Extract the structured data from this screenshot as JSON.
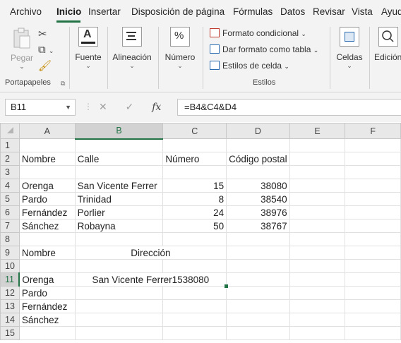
{
  "menu": {
    "tabs": [
      "Archivo",
      "Inicio",
      "Insertar",
      "Disposición de página",
      "Fórmulas",
      "Datos",
      "Revisar",
      "Vista",
      "Ayud"
    ],
    "active": "Inicio"
  },
  "ribbon": {
    "clipboard": {
      "paste_label": "Pegar",
      "group_label": "Portapapeles"
    },
    "font_label": "Fuente",
    "alignment_label": "Alineación",
    "number_label": "Número",
    "number_icon": "%",
    "styles": {
      "conditional": "Formato condicional",
      "as_table": "Dar formato como tabla",
      "cell_styles": "Estilos de celda",
      "group_label": "Estilos"
    },
    "cells_label": "Celdas",
    "editing_label": "Edición"
  },
  "formula_bar": {
    "name_box": "B11",
    "fx": "fx",
    "formula": "=B4&C4&D4"
  },
  "grid": {
    "columns": [
      "A",
      "B",
      "C",
      "D",
      "E",
      "F"
    ],
    "selected_column": "B",
    "selected_row": 11,
    "rows": [
      {
        "n": "1",
        "cells": [
          "",
          "",
          "",
          "",
          "",
          ""
        ]
      },
      {
        "n": "2",
        "cells": [
          "Nombre",
          "Calle",
          "Número",
          "Código postal",
          "",
          ""
        ]
      },
      {
        "n": "3",
        "cells": [
          "",
          "",
          "",
          "",
          "",
          ""
        ]
      },
      {
        "n": "4",
        "cells": [
          "Orenga",
          "San Vicente Ferrer",
          "15",
          "38080",
          "",
          ""
        ]
      },
      {
        "n": "5",
        "cells": [
          "Pardo",
          "Trinidad",
          "8",
          "38540",
          "",
          ""
        ]
      },
      {
        "n": "6",
        "cells": [
          "Fernández",
          "Porlier",
          "24",
          "38976",
          "",
          ""
        ]
      },
      {
        "n": "7",
        "cells": [
          "Sánchez",
          "Robayna",
          "50",
          "38767",
          "",
          ""
        ]
      },
      {
        "n": "8",
        "cells": [
          "",
          "",
          "",
          "",
          "",
          ""
        ]
      },
      {
        "n": "9",
        "cells": [
          "Nombre",
          "Dirección",
          "",
          "",
          "",
          ""
        ]
      },
      {
        "n": "10",
        "cells": [
          "",
          "",
          "",
          "",
          "",
          ""
        ]
      },
      {
        "n": "11",
        "cells": [
          "Orenga",
          "San Vicente Ferrer1538080",
          "",
          "",
          "",
          ""
        ]
      },
      {
        "n": "12",
        "cells": [
          "Pardo",
          "",
          "",
          "",
          "",
          ""
        ]
      },
      {
        "n": "13",
        "cells": [
          "Fernández",
          "",
          "",
          "",
          "",
          ""
        ]
      },
      {
        "n": "14",
        "cells": [
          "Sánchez",
          "",
          "",
          "",
          "",
          ""
        ]
      },
      {
        "n": "15",
        "cells": [
          "",
          "",
          "",
          "",
          "",
          ""
        ]
      }
    ]
  },
  "colors": {
    "accent": "#217346"
  }
}
